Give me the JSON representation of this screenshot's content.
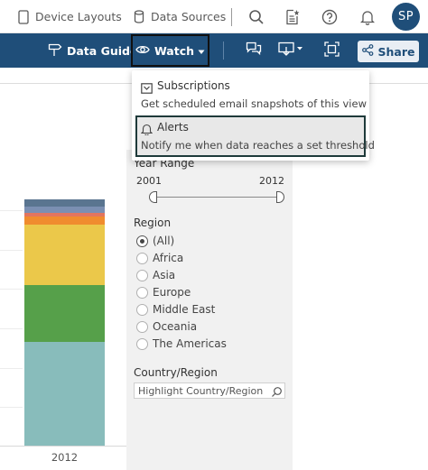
{
  "topbar": {
    "device_layouts": "Device Layouts",
    "data_sources": "Data Sources",
    "avatar_initials": "SP"
  },
  "toolbar": {
    "data_guide": "Data Guide",
    "watch": "Watch",
    "share": "Share"
  },
  "watch_menu": {
    "subscriptions": {
      "title": "Subscriptions",
      "description": "Get scheduled email snapshots of this view"
    },
    "alerts": {
      "title": "Alerts",
      "description": "Notify me when data reaches a set threshold"
    }
  },
  "filters": {
    "year_range": {
      "title": "Year Range",
      "min": "2001",
      "max": "2012"
    },
    "region": {
      "title": "Region",
      "selected": "(All)",
      "options": [
        "(All)",
        "Africa",
        "Asia",
        "Europe",
        "Middle East",
        "Oceania",
        "The Americas"
      ]
    },
    "country": {
      "title": "Country/Region",
      "placeholder": "Highlight Country/Region"
    }
  },
  "chart_data": {
    "type": "bar",
    "categories": [
      "2012"
    ],
    "colors": [
      "#88bcbb",
      "#56a04a",
      "#ebc84a",
      "#f08c2e",
      "#e2755f",
      "#7b8fb2",
      "#5a7590"
    ]
  }
}
